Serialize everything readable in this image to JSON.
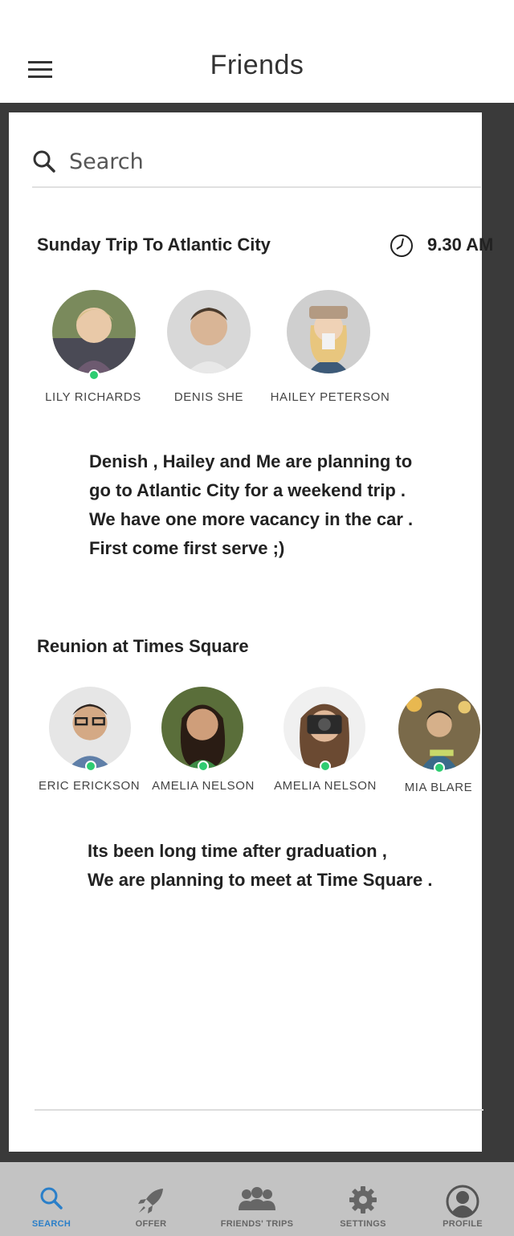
{
  "header": {
    "title": "Friends",
    "menu_icon": "hamburger-menu-icon"
  },
  "search": {
    "placeholder": "Search",
    "value": "",
    "icon": "search-icon"
  },
  "trips": [
    {
      "title": "Sunday Trip To Atlantic City",
      "time": "9.30 AM",
      "time_icon": "clock-icon",
      "friends": [
        {
          "name": "LILY RICHARDS",
          "online": true
        },
        {
          "name": "DENIS SHE",
          "online": false
        },
        {
          "name": "HAILEY PETERSON",
          "online": false
        }
      ],
      "description": [
        "Denish , Hailey and Me are planning to",
        "go to Atlantic City for a weekend trip .",
        "We have one more vacancy in the car .",
        "First come first serve ;)"
      ]
    },
    {
      "title": "Reunion at Times Square",
      "friends": [
        {
          "name": "ERIC ERICKSON",
          "online": true
        },
        {
          "name": "AMELIA NELSON",
          "online": true
        },
        {
          "name": "AMELIA NELSON",
          "online": true
        },
        {
          "name": "MIA BLARE",
          "online": true
        }
      ],
      "description": [
        "Its been long time after graduation ,",
        "We are planning to meet at Time Square ."
      ]
    }
  ],
  "tabs": [
    {
      "label": "SEARCH",
      "icon": "search-icon",
      "active": true
    },
    {
      "label": "OFFER",
      "icon": "rocket-icon",
      "active": false
    },
    {
      "label": "FRIENDS' TRIPS",
      "icon": "group-icon",
      "active": false
    },
    {
      "label": "SETTINGS",
      "icon": "gear-icon",
      "active": false
    },
    {
      "label": "PROFILE",
      "icon": "user-profile-icon",
      "active": false
    }
  ],
  "colors": {
    "accent": "#2a7fc9",
    "online": "#2ecc71",
    "frame": "#3a3a3a",
    "tabbar": "#c3c3c3"
  }
}
